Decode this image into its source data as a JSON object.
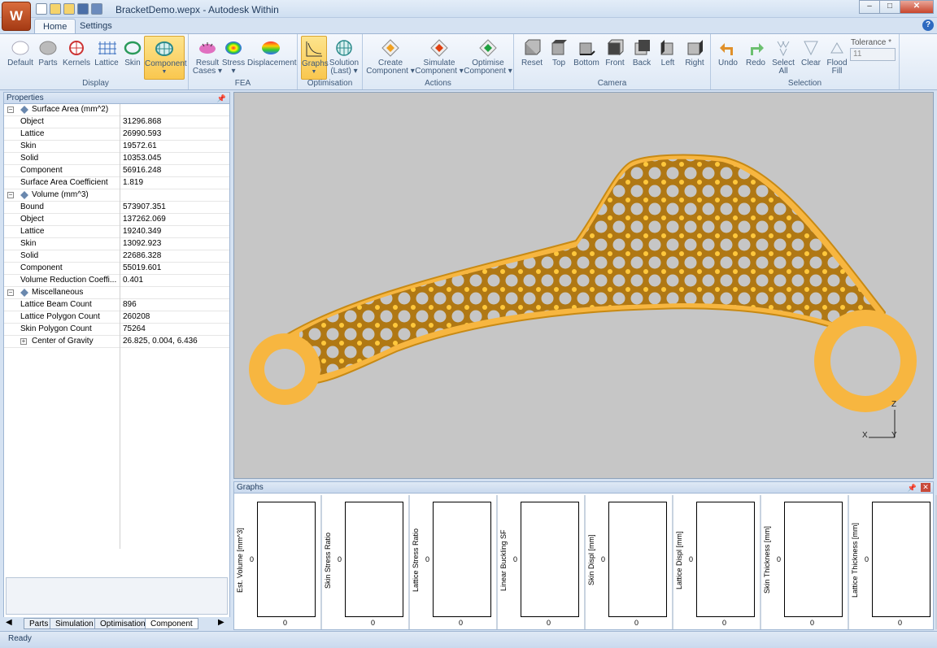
{
  "window": {
    "title": "BracketDemo.wepx - Autodesk Within",
    "app_button": "W",
    "min": "–",
    "max": "□",
    "close": "✕"
  },
  "tabs": [
    {
      "label": "Home"
    },
    {
      "label": "Settings"
    }
  ],
  "ribbon": {
    "groups": [
      {
        "label": "Display"
      },
      {
        "label": "FEA"
      },
      {
        "label": "Optimisation"
      },
      {
        "label": "Actions"
      },
      {
        "label": "Camera"
      },
      {
        "label": "Selection"
      }
    ],
    "display": [
      "Default",
      "Parts",
      "Kernels",
      "Lattice",
      "Skin",
      "Component"
    ],
    "fea": [
      {
        "l1": "Result",
        "l2": "Cases"
      },
      {
        "l1": "Stress",
        "l2": ""
      },
      {
        "l1": "Displacement",
        "l2": ""
      }
    ],
    "optimisation": [
      {
        "l1": "Graphs",
        "l2": ""
      },
      {
        "l1": "Solution",
        "l2": "(Last)"
      }
    ],
    "actions": [
      {
        "l1": "Create",
        "l2": "Component"
      },
      {
        "l1": "Simulate",
        "l2": "Component"
      },
      {
        "l1": "Optimise",
        "l2": "Component"
      }
    ],
    "camera": [
      "Reset",
      "Top",
      "Bottom",
      "Front",
      "Back",
      "Left",
      "Right"
    ],
    "selection": [
      {
        "l1": "Undo",
        "l2": ""
      },
      {
        "l1": "Redo",
        "l2": ""
      },
      {
        "l1": "Select",
        "l2": "All"
      },
      {
        "l1": "Clear",
        "l2": ""
      },
      {
        "l1": "Flood",
        "l2": "Fill"
      }
    ],
    "tolerance_label": "Tolerance *",
    "tolerance_value": "11"
  },
  "properties": {
    "title": "Properties",
    "rows": [
      {
        "name": "Surface Area (mm^2)",
        "value": "",
        "cat": true
      },
      {
        "name": "Object",
        "value": "31296.868"
      },
      {
        "name": "Lattice",
        "value": "26990.593"
      },
      {
        "name": "Skin",
        "value": "19572.61"
      },
      {
        "name": "Solid",
        "value": "10353.045"
      },
      {
        "name": "Component",
        "value": "56916.248"
      },
      {
        "name": "Surface Area Coefficient",
        "value": "1.819"
      },
      {
        "name": "Volume (mm^3)",
        "value": "",
        "cat": true
      },
      {
        "name": "Bound",
        "value": "573907.351"
      },
      {
        "name": "Object",
        "value": "137262.069"
      },
      {
        "name": "Lattice",
        "value": "19240.349"
      },
      {
        "name": "Skin",
        "value": "13092.923"
      },
      {
        "name": "Solid",
        "value": "22686.328"
      },
      {
        "name": "Component",
        "value": "55019.601"
      },
      {
        "name": "Volume Reduction Coeffi...",
        "value": "0.401"
      },
      {
        "name": "Miscellaneous",
        "value": "",
        "cat": true
      },
      {
        "name": "Lattice Beam Count",
        "value": "896"
      },
      {
        "name": "Lattice Polygon Count",
        "value": "260208"
      },
      {
        "name": "Skin Polygon Count",
        "value": "75264"
      },
      {
        "name": "Center of Gravity",
        "value": "26.825, 0.004, 6.436",
        "sub": true
      }
    ],
    "bottom_tabs": [
      "Parts",
      "Simulation",
      "Optimisation",
      "Component"
    ],
    "active_tab": "Component"
  },
  "viewport": {
    "axes": {
      "z": "Z",
      "x": "X",
      "y": "Y"
    }
  },
  "graphs": {
    "title": "Graphs",
    "panels": [
      {
        "ylabel": "Est. Volume [mm^3]",
        "y0": "0",
        "x0": "0"
      },
      {
        "ylabel": "Skin Stress Ratio",
        "y0": "0",
        "x0": "0"
      },
      {
        "ylabel": "Lattice Stress Ratio",
        "y0": "0",
        "x0": "0"
      },
      {
        "ylabel": "Linear Buckling SF",
        "y0": "0",
        "x0": "0"
      },
      {
        "ylabel": "Skin Displ [mm]",
        "y0": "0",
        "x0": "0"
      },
      {
        "ylabel": "Lattice Displ [mm]",
        "y0": "0",
        "x0": "0"
      },
      {
        "ylabel": "Skin Thickness [mm]",
        "y0": "0",
        "x0": "0"
      },
      {
        "ylabel": "Lattice Thickness [mm]",
        "y0": "0",
        "x0": "0"
      }
    ]
  },
  "status": "Ready"
}
